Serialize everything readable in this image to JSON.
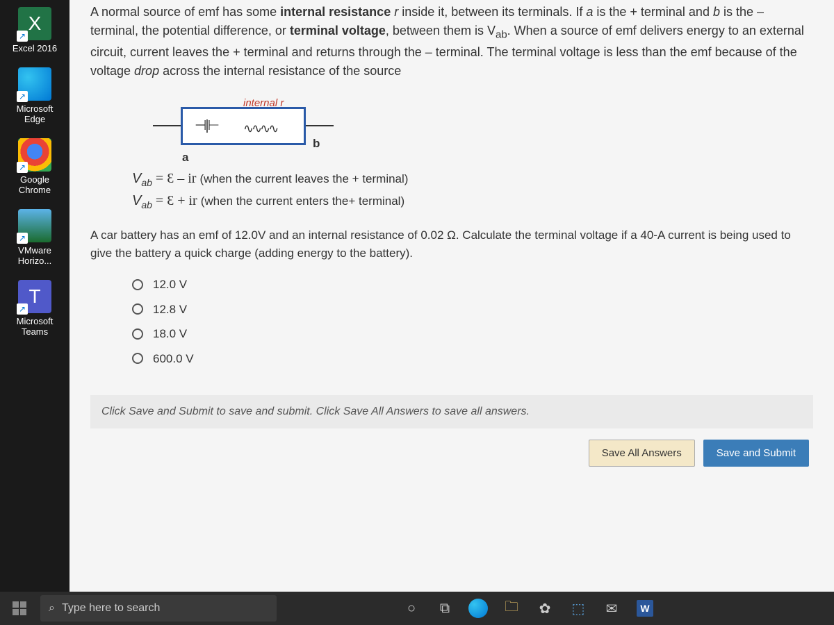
{
  "desktop": {
    "icons": [
      {
        "label": "Excel 2016"
      },
      {
        "label": "Microsoft Edge"
      },
      {
        "label": "Google Chrome"
      },
      {
        "label": "VMware Horizo..."
      },
      {
        "label": "Microsoft Teams"
      }
    ]
  },
  "content": {
    "intro_html": "A normal source of emf has some <b>internal resistance</b> <i>r</i> inside it, between its terminals. If <i>a</i> is the + terminal and <i>b</i> is the – terminal, the potential difference, or <b>terminal voltage</b>, between them is V<sub>ab</sub>. When a source of emf delivers energy to an external circuit, current leaves the + terminal and returns through the – terminal. The terminal voltage is less than the emf because of the voltage <i>drop</i> across the internal resistance of the source",
    "diagram": {
      "internal_label": "internal  r",
      "terminal_a": "a",
      "terminal_b": "b"
    },
    "eq1_prefix": "V",
    "eq1_sub": "ab",
    "eq1_body": " = Ɛ – ir ",
    "eq1_cond": "(when the current leaves the + terminal)",
    "eq2_prefix": "V",
    "eq2_sub": "ab",
    "eq2_body": " = Ɛ + ir ",
    "eq2_cond": "(when the current enters the+ terminal)",
    "question": "A car battery has an emf of 12.0V and an internal resistance of 0.02 Ω.  Calculate the terminal voltage if a 40-A current is being used to give the battery a quick charge (adding energy to the battery).",
    "answers": [
      "12.0 V",
      "12.8 V",
      "18.0 V",
      "600.0 V"
    ],
    "instruction": "Click Save and Submit to save and submit. Click Save All Answers to save all answers.",
    "btn_save_all": "Save All Answers",
    "btn_submit": "Save and Submit"
  },
  "taskbar": {
    "search_placeholder": "Type here to search"
  }
}
